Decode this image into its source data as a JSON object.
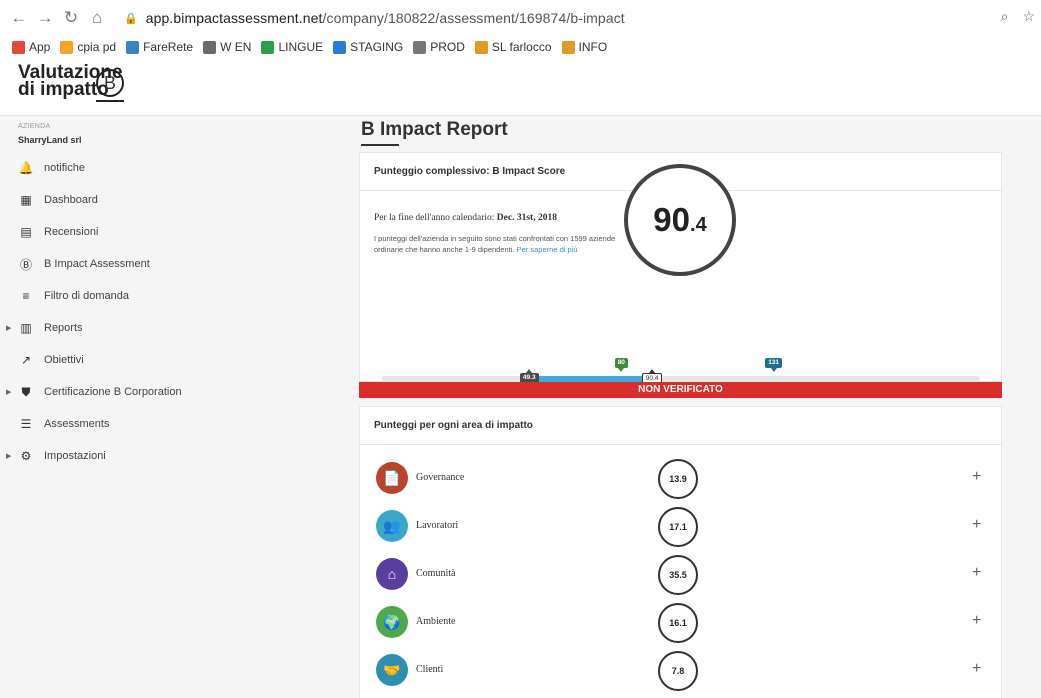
{
  "browser": {
    "url_host": "app.bimpactassessment.net",
    "url_path": "/company/180822/assessment/169874/b-impact",
    "bookmarks": [
      "App",
      "cpia pd",
      "FareRete",
      "W EN",
      "LINGUE",
      "STAGING",
      "PROD",
      "SL farlocco",
      "INFO"
    ]
  },
  "logo": {
    "line1": "Valutazione",
    "line2": "di impatto",
    "mark": "B"
  },
  "sidebar": {
    "company_label": "AZIENDA",
    "company_name": "SharryLand srl",
    "items": [
      {
        "label": "notifiche",
        "icon": "bell-icon",
        "expandable": false
      },
      {
        "label": "Dashboard",
        "icon": "dashboard-icon",
        "expandable": false
      },
      {
        "label": "Recensioni",
        "icon": "reviews-icon",
        "expandable": false
      },
      {
        "label": "B Impact Assessment",
        "icon": "b-circle-icon",
        "expandable": false
      },
      {
        "label": "Filtro di domanda",
        "icon": "filter-icon",
        "expandable": false
      },
      {
        "label": "Reports",
        "icon": "bar-chart-icon",
        "expandable": true
      },
      {
        "label": "Obiettivi",
        "icon": "trend-icon",
        "expandable": false
      },
      {
        "label": "Certificazione B Corporation",
        "icon": "shield-icon",
        "expandable": true
      },
      {
        "label": "Assessments",
        "icon": "list-icon",
        "expandable": false
      },
      {
        "label": "Impostazioni",
        "icon": "gear-icon",
        "expandable": true
      }
    ]
  },
  "main": {
    "title": "B Impact Report",
    "score_card": {
      "header": "Punteggio complessivo: B Impact Score",
      "period_prefix": "Per la fine dell'anno calendario:",
      "period_date": "Dec. 31st, 2018",
      "compare_text": "I punteggi dell'azienda in seguito sono stati confrontati con 1599 aziende ordinarie che hanno anche 1-9 dipendenti.",
      "compare_link": "Per saperne di più",
      "score_int": "90",
      "score_dec": ".4",
      "scale": {
        "max": 200,
        "score": 90.4,
        "low": 49.3,
        "median": 80,
        "high": 131,
        "labels": {
          "low": "49.3",
          "median": "80",
          "high": "131",
          "current": "90.4"
        },
        "ticks": [
          "0",
          "50",
          "100",
          "150",
          "200+"
        ]
      },
      "status": "NON VERIFICATO"
    },
    "areas_card": {
      "header": "Punteggi per ogni area di impatto",
      "areas": [
        {
          "name": "Governance",
          "score": "13.9",
          "color": "#b8462b"
        },
        {
          "name": "Lavoratori",
          "score": "17.1",
          "color": "#3ba6c7"
        },
        {
          "name": "Comunità",
          "score": "35.5",
          "color": "#5a3e9e"
        },
        {
          "name": "Ambiente",
          "score": "16.1",
          "color": "#4fa84a"
        },
        {
          "name": "Clienti",
          "score": "7.8",
          "color": "#2f8fb0"
        }
      ]
    }
  }
}
